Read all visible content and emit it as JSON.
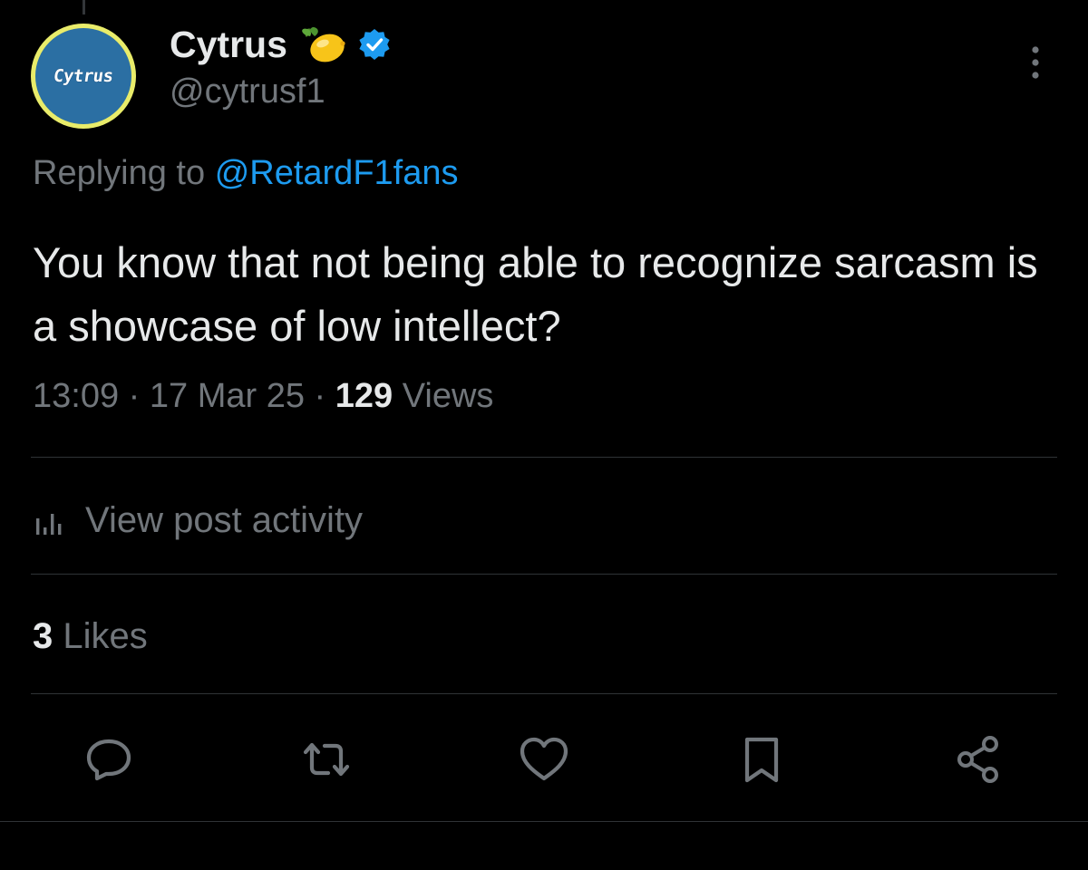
{
  "author": {
    "display_name": "Cytrus",
    "handle": "@cytrusf1",
    "avatar_text": "Cytrus",
    "emoji_icon": "lemon-icon",
    "verified_icon": "verified-badge-icon",
    "avatar_colors": {
      "ring": "#e9ec6a",
      "fill": "#2b6fa3"
    }
  },
  "reply": {
    "prefix": "Replying to",
    "target": "@RetardF1fans"
  },
  "post": {
    "text": "You know that not being able to recognize sarcasm is a showcase of low intellect?",
    "time": "13:09",
    "date": "17 Mar 25",
    "views_count": "129",
    "views_label": "Views",
    "separator": "·"
  },
  "activity": {
    "label": "View post activity",
    "icon": "bar-chart-icon"
  },
  "likes": {
    "count": "3",
    "label": "Likes"
  },
  "actions": {
    "reply_icon": "reply-icon",
    "retweet_icon": "retweet-icon",
    "like_icon": "heart-icon",
    "bookmark_icon": "bookmark-icon",
    "share_icon": "share-icon"
  },
  "colors": {
    "background": "#000000",
    "text_primary": "#e7e9ea",
    "text_secondary": "#71767b",
    "link": "#1d9bf0",
    "verified": "#1d9bf0",
    "divider": "#2f3336"
  }
}
